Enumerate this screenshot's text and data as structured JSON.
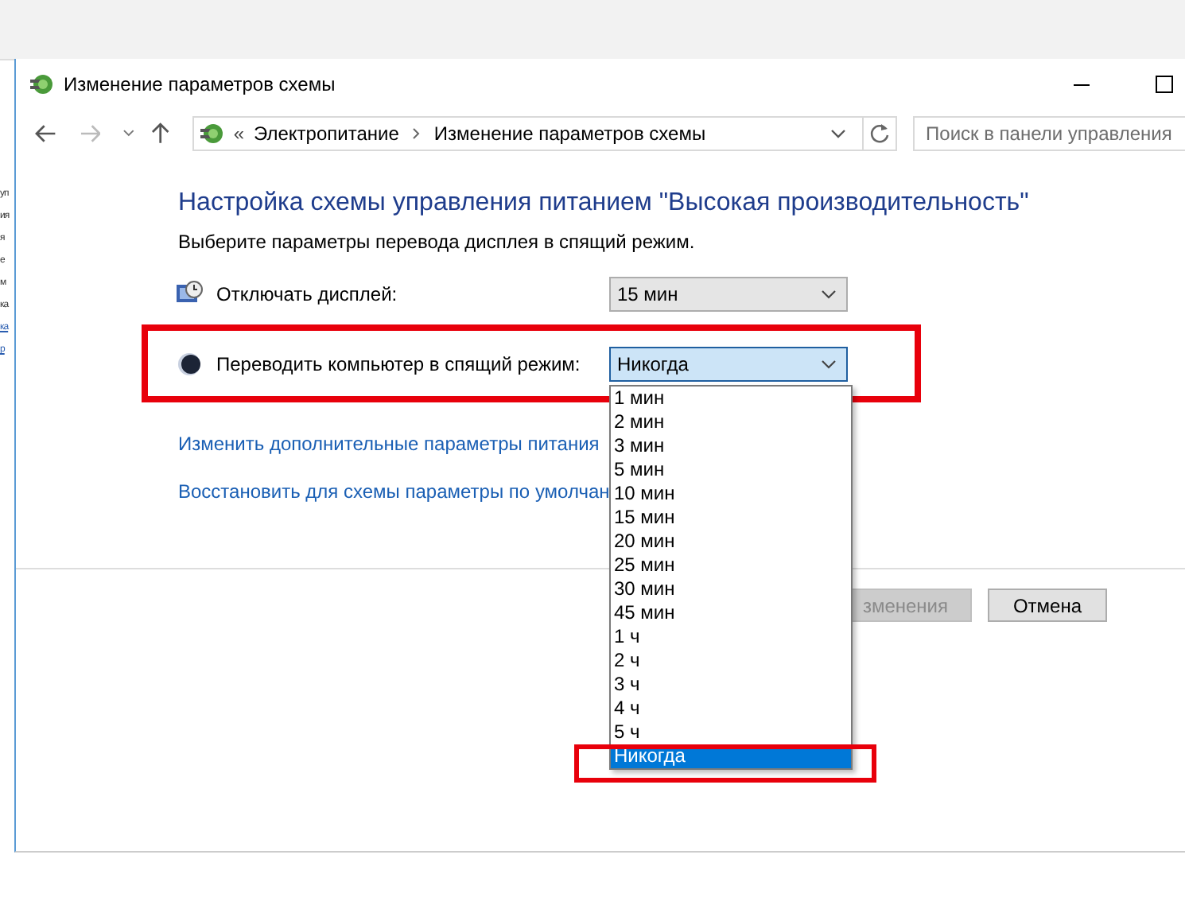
{
  "background_window": {
    "fragments": [
      "уп",
      "ия",
      "я",
      "е",
      "м",
      "ка"
    ],
    "links": [
      "ка",
      "р"
    ]
  },
  "window": {
    "title": "Изменение параметров схемы"
  },
  "address_bar": {
    "overflow": "«",
    "breadcrumbs": [
      "Электропитание",
      "Изменение параметров схемы"
    ]
  },
  "search": {
    "placeholder": "Поиск в панели управления"
  },
  "heading": "Настройка схемы управления питанием \"Высокая производительность\"",
  "subheading": "Выберите параметры перевода дисплея в спящий режим.",
  "settings": [
    {
      "kind": "display",
      "label": "Отключать дисплей:",
      "value": "15 мин",
      "open": false,
      "highlighted": false
    },
    {
      "kind": "sleep",
      "label": "Переводить компьютер в спящий режим:",
      "value": "Никогда",
      "open": true,
      "highlighted": true
    }
  ],
  "dropdown_options": [
    {
      "label": "1 мин",
      "selected": false,
      "highlighted": false
    },
    {
      "label": "2 мин",
      "selected": false,
      "highlighted": false
    },
    {
      "label": "3 мин",
      "selected": false,
      "highlighted": false
    },
    {
      "label": "5 мин",
      "selected": false,
      "highlighted": false
    },
    {
      "label": "10 мин",
      "selected": false,
      "highlighted": false
    },
    {
      "label": "15 мин",
      "selected": false,
      "highlighted": false
    },
    {
      "label": "20 мин",
      "selected": false,
      "highlighted": false
    },
    {
      "label": "25 мин",
      "selected": false,
      "highlighted": false
    },
    {
      "label": "30 мин",
      "selected": false,
      "highlighted": false
    },
    {
      "label": "45 мин",
      "selected": false,
      "highlighted": false
    },
    {
      "label": "1 ч",
      "selected": false,
      "highlighted": false
    },
    {
      "label": "2 ч",
      "selected": false,
      "highlighted": false
    },
    {
      "label": "3 ч",
      "selected": false,
      "highlighted": false
    },
    {
      "label": "4 ч",
      "selected": false,
      "highlighted": false
    },
    {
      "label": "5 ч",
      "selected": false,
      "highlighted": false
    },
    {
      "label": "Никогда",
      "selected": true,
      "highlighted": true
    }
  ],
  "links": [
    "Изменить дополнительные параметры питания",
    "Восстановить для схемы параметры по умолчан"
  ],
  "buttons": [
    {
      "label": "зменения",
      "disabled": true
    },
    {
      "label": "Отмена",
      "disabled": false
    }
  ]
}
